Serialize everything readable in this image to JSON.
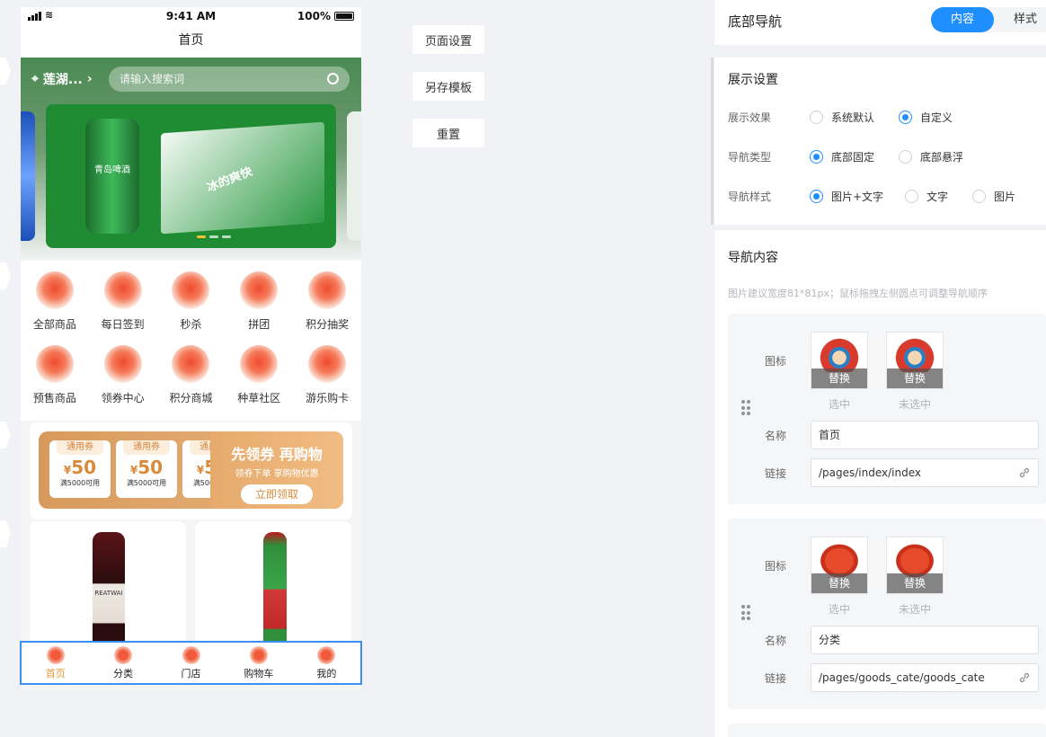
{
  "phone": {
    "status": {
      "time": "9:41 AM",
      "battery": "100%"
    },
    "title": "首页",
    "location": "莲湖...",
    "search_placeholder": "请输入搜索词",
    "banner": {
      "can_text": "青岛啤酒",
      "box_text": "冰的爽快"
    },
    "grid_nav": [
      [
        "全部商品",
        "每日签到",
        "秒杀",
        "拼团",
        "积分抽奖"
      ],
      [
        "预售商品",
        "领券中心",
        "积分商城",
        "种草社区",
        "游乐购卡"
      ]
    ],
    "coupon": {
      "tag": "通用券",
      "currency": "¥",
      "amount": "50",
      "condition": "满5000可用",
      "headline": "先领券 再购物",
      "sub": "领券下单 享购物优惠",
      "button": "立即领取"
    },
    "products": [
      {
        "label": "REATWAI"
      },
      {
        "label": ""
      }
    ],
    "tabbar": [
      "首页",
      "分类",
      "门店",
      "购物车",
      "我的"
    ]
  },
  "actions": {
    "page_settings": "页面设置",
    "save_template": "另存模板",
    "reset": "重置"
  },
  "panel": {
    "title": "底部导航",
    "tab_content": "内容",
    "tab_style": "样式",
    "display": {
      "title": "展示设置",
      "effect_label": "展示效果",
      "effect_options": [
        "系统默认",
        "自定义"
      ],
      "type_label": "导航类型",
      "type_options": [
        "底部固定",
        "底部悬浮"
      ],
      "style_label": "导航样式",
      "style_options": [
        "图片+文字",
        "文字",
        "图片"
      ]
    },
    "nav": {
      "title": "导航内容",
      "hint": "图片建议宽度81*81px；鼠标拖拽左侧圆点可调整导航顺序",
      "icon_label": "图标",
      "name_label": "名称",
      "link_label": "链接",
      "replace": "替换",
      "selected": "选中",
      "unselected": "未选中",
      "items": [
        {
          "name": "首页",
          "link": "/pages/index/index"
        },
        {
          "name": "分类",
          "link": "/pages/goods_cate/goods_cate"
        }
      ]
    }
  },
  "colors": {
    "accent": "#1f8fff",
    "tab_active": "#e59b3c",
    "coupon": "#d89a5c"
  }
}
